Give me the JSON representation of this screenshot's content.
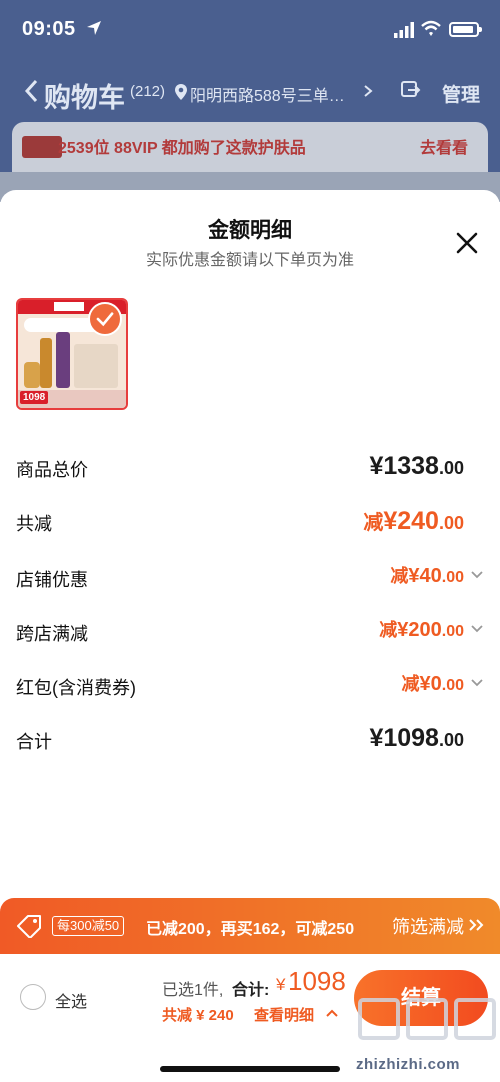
{
  "status_bar": {
    "time": "09:05"
  },
  "cart_page": {
    "title": "购物车",
    "count": "(212)",
    "address": "阳明西路588号三单…",
    "manage": "管理",
    "promo_text": "2539位 88VIP 都加购了这款护肤品",
    "promo_link": "去看看"
  },
  "sheet": {
    "title": "金额明细",
    "subtitle": "实际优惠金额请以下单页为准",
    "product": {
      "thumb_price": "1098"
    },
    "rows": [
      {
        "label": "商品总价",
        "prefix": "",
        "currency": "¥",
        "integer": "1338",
        "decimal": ".00",
        "tone": "dark",
        "has_chevron": false
      },
      {
        "label": "共减",
        "prefix": "减",
        "currency": "¥",
        "integer": "240",
        "decimal": ".00",
        "tone": "orange",
        "has_chevron": false
      },
      {
        "label": "店铺优惠",
        "prefix": "减",
        "currency": "¥",
        "integer": "40",
        "decimal": ".00",
        "tone": "orange",
        "has_chevron": true
      },
      {
        "label": "跨店满减",
        "prefix": "减",
        "currency": "¥",
        "integer": "200",
        "decimal": ".00",
        "tone": "orange",
        "has_chevron": true
      },
      {
        "label": "红包(含消费券)",
        "prefix": "减",
        "currency": "¥",
        "integer": "0",
        "decimal": ".00",
        "tone": "orange",
        "has_chevron": true
      },
      {
        "label": "合计",
        "prefix": "",
        "currency": "¥",
        "integer": "1098",
        "decimal": ".00",
        "tone": "dark",
        "has_chevron": false
      }
    ]
  },
  "discount_bar": {
    "rule": "每300减50",
    "status": "已减200，再买162，可减250",
    "filter_link": "筛选满减"
  },
  "checkout": {
    "select_all": "全选",
    "selected": "已选1件,",
    "total_label": "合计:",
    "currency": "¥",
    "total": "1098",
    "reduced": "共减 ¥ 240",
    "details": "查看明细",
    "button": "结算"
  },
  "watermark": {
    "text": "zhizhizhi.com"
  },
  "colors": {
    "accent": "#ef5b22",
    "header_bg": "#4a5f8f"
  }
}
